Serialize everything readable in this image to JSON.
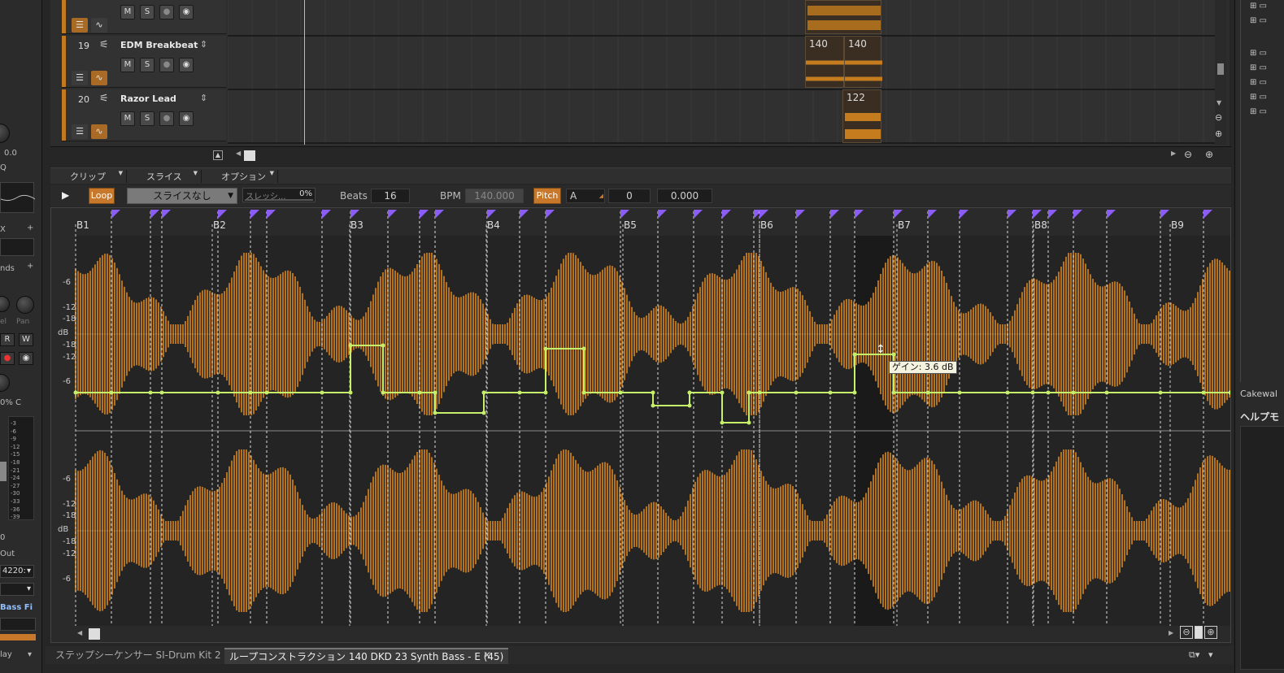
{
  "colors": {
    "accent": "#c8782a",
    "waveform": "#c47c1f",
    "envelope": "#c6f06a",
    "marker": "#8b5cf6"
  },
  "left_strip": {
    "vol": "0.0",
    "q": "Q",
    "x": "X",
    "sends": "nds",
    "r": "R",
    "w": "W",
    "pan_pct": "0% C",
    "zero": "0",
    "out": "Out",
    "sr": "4220:",
    "bass": "Bass Fi",
    "play": "lay",
    "meter": [
      "-3",
      "-6",
      "-9",
      "-12",
      "-15",
      "-18",
      "-21",
      "-24",
      "-27",
      "-30",
      "-33",
      "-36",
      "-39"
    ],
    "knob_labels": [
      "el",
      "Pan"
    ]
  },
  "tracks": [
    {
      "num": "",
      "name": "",
      "m": "M",
      "s": "S"
    },
    {
      "num": "19",
      "name": "EDM Breakbeat",
      "m": "M",
      "s": "S"
    },
    {
      "num": "20",
      "name": "Razor Lead",
      "m": "M",
      "s": "S"
    }
  ],
  "clips": [
    {
      "label": ""
    },
    {
      "label": "140"
    },
    {
      "label": "140"
    },
    {
      "label": "122"
    }
  ],
  "editor": {
    "menus": [
      "クリップ",
      "スライス",
      "オプション"
    ],
    "loop": "Loop",
    "slice_select": "スライスなし",
    "threshold_label": "スレッシ...",
    "threshold_val": "0%",
    "beats_label": "Beats",
    "beats": "16",
    "bpm_label": "BPM",
    "bpm": "140.000",
    "pitch": "Pitch",
    "key": "A",
    "semitones": "0",
    "cents": "0.000"
  },
  "ruler": [
    "B1",
    "B2",
    "B3",
    "B4",
    "B5",
    "B6",
    "B7",
    "B8",
    "B9"
  ],
  "db_labels_top": [
    "-6",
    "-12",
    "-18",
    "dB",
    "-18",
    "-12",
    "-6"
  ],
  "db_labels_bottom": [
    "-6",
    "-12",
    "-18",
    "dB",
    "-18",
    "-12",
    "-6"
  ],
  "tooltip": "ゲイン: 3.6 dB",
  "bottom_tabs": [
    "ステップシーケンサー  SI-Drum Kit 2",
    "ループコンストラクション  140 DKD 23 Synth Bass - E (45)"
  ],
  "right_panel": {
    "cakewalk": "Cakewal",
    "help": "ヘルプモ"
  }
}
